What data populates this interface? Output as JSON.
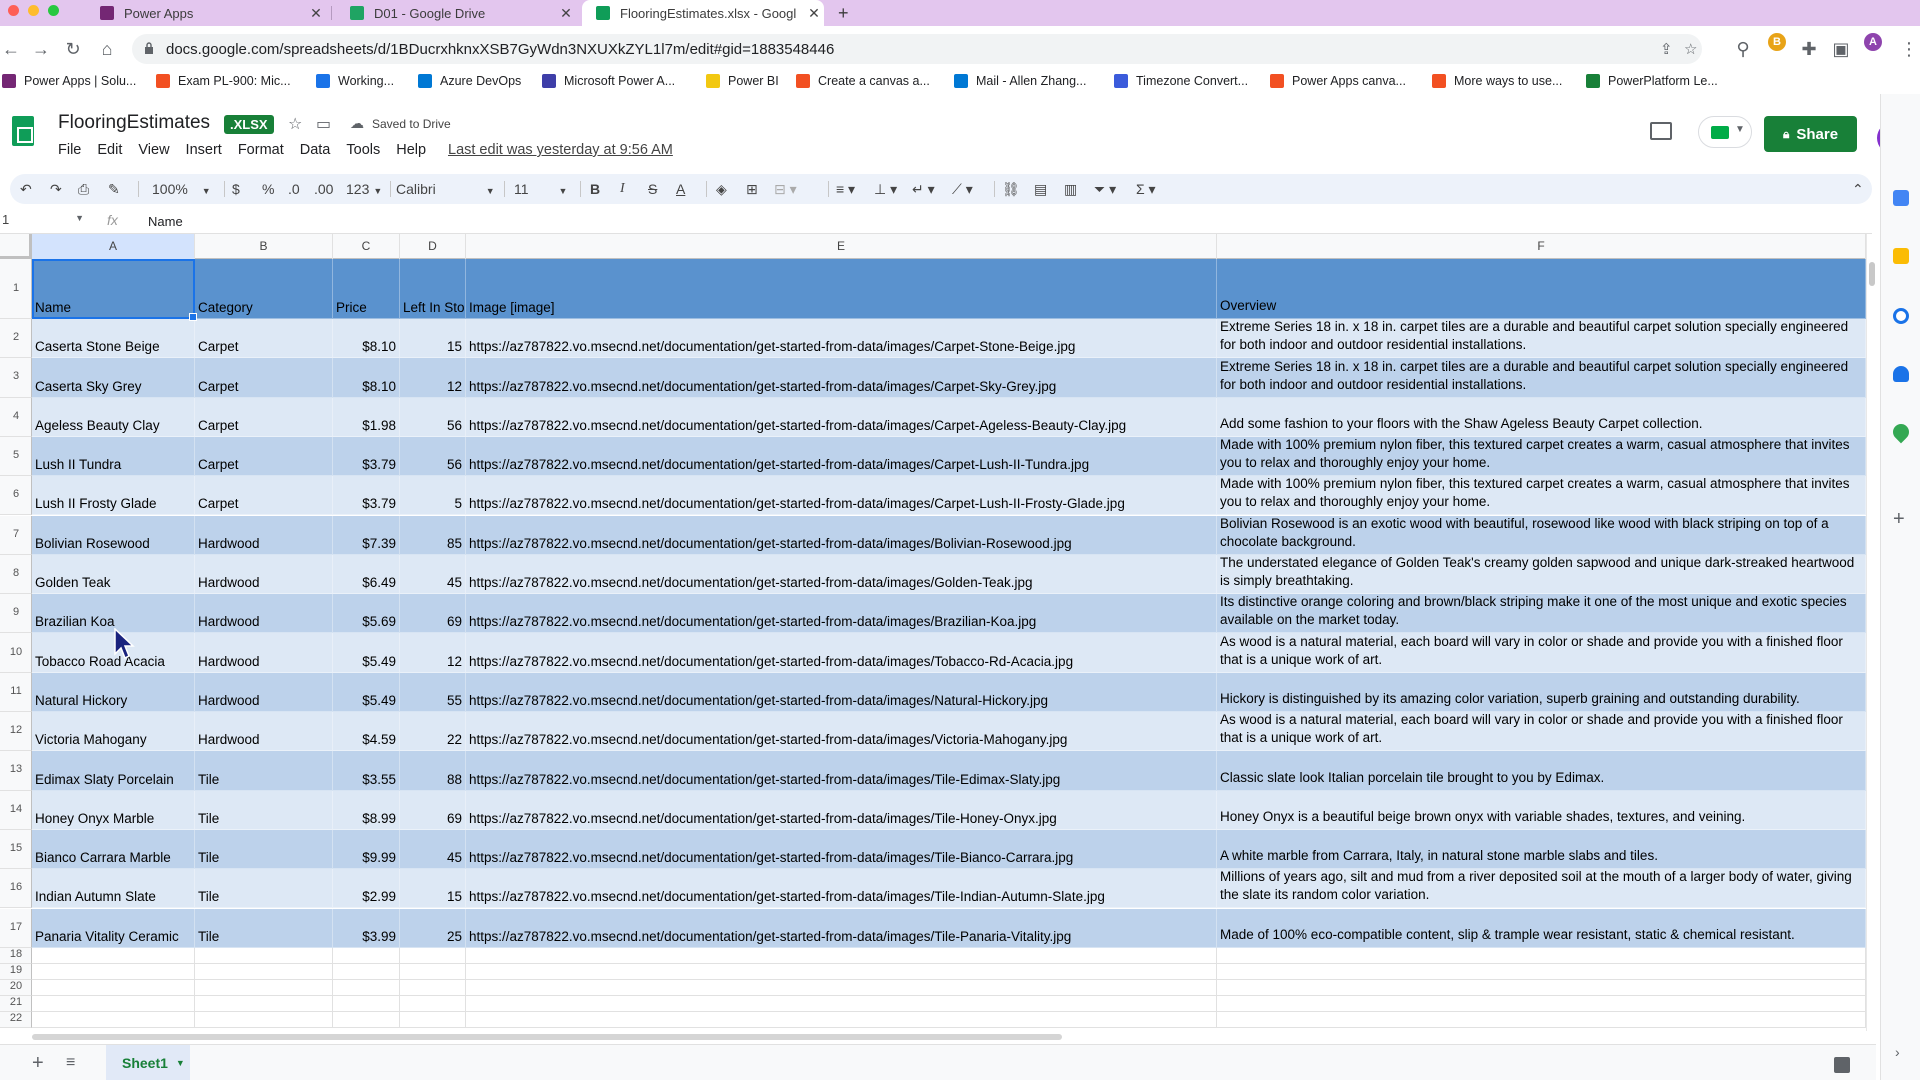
{
  "browser": {
    "tabs": [
      {
        "label": "Power Apps",
        "close": "✕",
        "icon_color": "#742774"
      },
      {
        "label": "D01 - Google Drive",
        "close": "✕",
        "icon_color": "#1fa463"
      },
      {
        "label": "FlooringEstimates.xlsx - Googl",
        "close": "✕",
        "icon_color": "#0f9d58"
      }
    ],
    "new_tab": "+",
    "url": "docs.google.com/spreadsheets/d/1BDucrxhknxXSB7GyWdn3NXUXkZYL1l7m/edit#gid=1883548446",
    "bookmarks": [
      {
        "label": "Power Apps | Solu...",
        "icon_color": "#742774"
      },
      {
        "label": "Exam PL-900: Mic...",
        "icon_color": "#f25022"
      },
      {
        "label": "Working...",
        "icon_color": "#1a73e8"
      },
      {
        "label": "Azure DevOps",
        "icon_color": "#0078d4"
      },
      {
        "label": "Microsoft Power A...",
        "icon_color": "#3e3ea8"
      },
      {
        "label": "Power BI",
        "icon_color": "#f2c811"
      },
      {
        "label": "Create a canvas a...",
        "icon_color": "#f25022"
      },
      {
        "label": "Mail - Allen Zhang...",
        "icon_color": "#0078d4"
      },
      {
        "label": "Timezone Convert...",
        "icon_color": "#3b5bdb"
      },
      {
        "label": "Power Apps canva...",
        "icon_color": "#f25022"
      },
      {
        "label": "More ways to use...",
        "icon_color": "#f25022"
      },
      {
        "label": "PowerPlatform Le...",
        "icon_color": "#188038"
      }
    ],
    "extension_b": "B",
    "profile_letter": "A"
  },
  "app": {
    "doc_name": "FlooringEstimates",
    "file_badge": ".XLSX",
    "saved_status": "Saved to Drive",
    "menu": [
      "File",
      "Edit",
      "View",
      "Insert",
      "Format",
      "Data",
      "Tools",
      "Help"
    ],
    "last_edit": "Last edit was yesterday at 9:56 AM",
    "share_label": "Share",
    "avatar_letter": "A",
    "accent": "#188038"
  },
  "toolbar": {
    "zoom": "100%",
    "currency": "$",
    "percent": "%",
    "dec_decrease": ".0",
    "dec_increase": ".00",
    "number_format": "123",
    "font": "Calibri",
    "font_size": "11",
    "bold": "B",
    "italic": "I",
    "strike": "S",
    "text_color": "A"
  },
  "formula_bar": {
    "cell_ref": "1",
    "fx": "fx",
    "content": "Name"
  },
  "sheet": {
    "columns": [
      "A",
      "B",
      "C",
      "D",
      "E",
      "F"
    ],
    "header": [
      "Name",
      "Category",
      "Price",
      "Left In Sto",
      "Image [image]",
      "Overview"
    ],
    "rows": [
      [
        "Caserta Stone Beige",
        "Carpet",
        "$8.10",
        "15",
        "https://az787822.vo.msecnd.net/documentation/get-started-from-data/images/Carpet-Stone-Beige.jpg",
        "Extreme Series 18 in. x 18 in. carpet tiles are a durable and beautiful carpet solution specially engineered for both indoor and outdoor residential installations."
      ],
      [
        "Caserta Sky Grey",
        "Carpet",
        "$8.10",
        "12",
        "https://az787822.vo.msecnd.net/documentation/get-started-from-data/images/Carpet-Sky-Grey.jpg",
        "Extreme Series 18 in. x 18 in. carpet tiles are a durable and beautiful carpet solution specially engineered for both indoor and outdoor residential installations."
      ],
      [
        "Ageless Beauty Clay",
        "Carpet",
        "$1.98",
        "56",
        "https://az787822.vo.msecnd.net/documentation/get-started-from-data/images/Carpet-Ageless-Beauty-Clay.jpg",
        "Add some fashion to your floors with the Shaw Ageless Beauty Carpet collection."
      ],
      [
        "Lush II Tundra",
        "Carpet",
        "$3.79",
        "56",
        "https://az787822.vo.msecnd.net/documentation/get-started-from-data/images/Carpet-Lush-II-Tundra.jpg",
        "Made with 100% premium nylon fiber, this textured carpet creates a warm, casual atmosphere that invites you to relax and thoroughly enjoy your home."
      ],
      [
        "Lush II Frosty Glade",
        "Carpet",
        "$3.79",
        "5",
        "https://az787822.vo.msecnd.net/documentation/get-started-from-data/images/Carpet-Lush-II-Frosty-Glade.jpg",
        "Made with 100% premium nylon fiber, this textured carpet creates a warm, casual atmosphere that invites you to relax and thoroughly enjoy your home."
      ],
      [
        "Bolivian Rosewood",
        "Hardwood",
        "$7.39",
        "85",
        "https://az787822.vo.msecnd.net/documentation/get-started-from-data/images/Bolivian-Rosewood.jpg",
        "Bolivian Rosewood is an exotic wood with beautiful, rosewood like wood with black striping on top of a chocolate background."
      ],
      [
        "Golden Teak",
        "Hardwood",
        "$6.49",
        "45",
        "https://az787822.vo.msecnd.net/documentation/get-started-from-data/images/Golden-Teak.jpg",
        "The understated elegance of Golden Teak's creamy golden sapwood and unique dark-streaked heartwood is simply breathtaking."
      ],
      [
        "Brazilian Koa",
        "Hardwood",
        "$5.69",
        "69",
        "https://az787822.vo.msecnd.net/documentation/get-started-from-data/images/Brazilian-Koa.jpg",
        "Its distinctive orange coloring and brown/black striping make it one of the most unique and exotic species available on the market today."
      ],
      [
        "Tobacco Road Acacia",
        "Hardwood",
        "$5.49",
        "12",
        "https://az787822.vo.msecnd.net/documentation/get-started-from-data/images/Tobacco-Rd-Acacia.jpg",
        "As wood is a natural material, each board will vary in color or shade and provide you with a finished floor that is a unique work of art."
      ],
      [
        "Natural Hickory",
        "Hardwood",
        "$5.49",
        "55",
        "https://az787822.vo.msecnd.net/documentation/get-started-from-data/images/Natural-Hickory.jpg",
        "Hickory is distinguished by its amazing color variation, superb graining and outstanding durability."
      ],
      [
        "Victoria Mahogany",
        "Hardwood",
        "$4.59",
        "22",
        "https://az787822.vo.msecnd.net/documentation/get-started-from-data/images/Victoria-Mahogany.jpg",
        "As wood is a natural material, each board will vary in color or shade and provide you with a finished floor that is a unique work of art."
      ],
      [
        "Edimax Slaty Porcelain",
        "Tile",
        "$3.55",
        "88",
        "https://az787822.vo.msecnd.net/documentation/get-started-from-data/images/Tile-Edimax-Slaty.jpg",
        "Classic slate look Italian porcelain tile brought to you by Edimax."
      ],
      [
        "Honey Onyx Marble",
        "Tile",
        "$8.99",
        "69",
        "https://az787822.vo.msecnd.net/documentation/get-started-from-data/images/Tile-Honey-Onyx.jpg",
        "Honey Onyx is a beautiful beige brown onyx with variable shades, textures, and veining."
      ],
      [
        "Bianco Carrara Marble",
        "Tile",
        "$9.99",
        "45",
        "https://az787822.vo.msecnd.net/documentation/get-started-from-data/images/Tile-Bianco-Carrara.jpg",
        "A white marble from Carrara, Italy, in natural stone marble slabs and tiles."
      ],
      [
        "Indian Autumn Slate",
        "Tile",
        "$2.99",
        "15",
        "https://az787822.vo.msecnd.net/documentation/get-started-from-data/images/Tile-Indian-Autumn-Slate.jpg",
        "Millions of years ago, silt and mud from a river deposited soil at the mouth of a larger body of water, giving the slate its random color variation."
      ],
      [
        "Panaria Vitality Ceramic",
        "Tile",
        "$3.99",
        "25",
        "https://az787822.vo.msecnd.net/documentation/get-started-from-data/images/Tile-Panaria-Vitality.jpg",
        "Made of 100% eco-compatible content, slip & trample wear resistant, static & chemical resistant."
      ]
    ],
    "empty_rows": [
      "18",
      "19",
      "20",
      "21",
      "22"
    ],
    "header_color": "#5a92ce",
    "band_colors": [
      "#dde8f5",
      "#bdd2eb"
    ]
  },
  "bottom": {
    "add_sheet": "+",
    "all_sheets": "≡",
    "sheet_tab": "Sheet1"
  }
}
